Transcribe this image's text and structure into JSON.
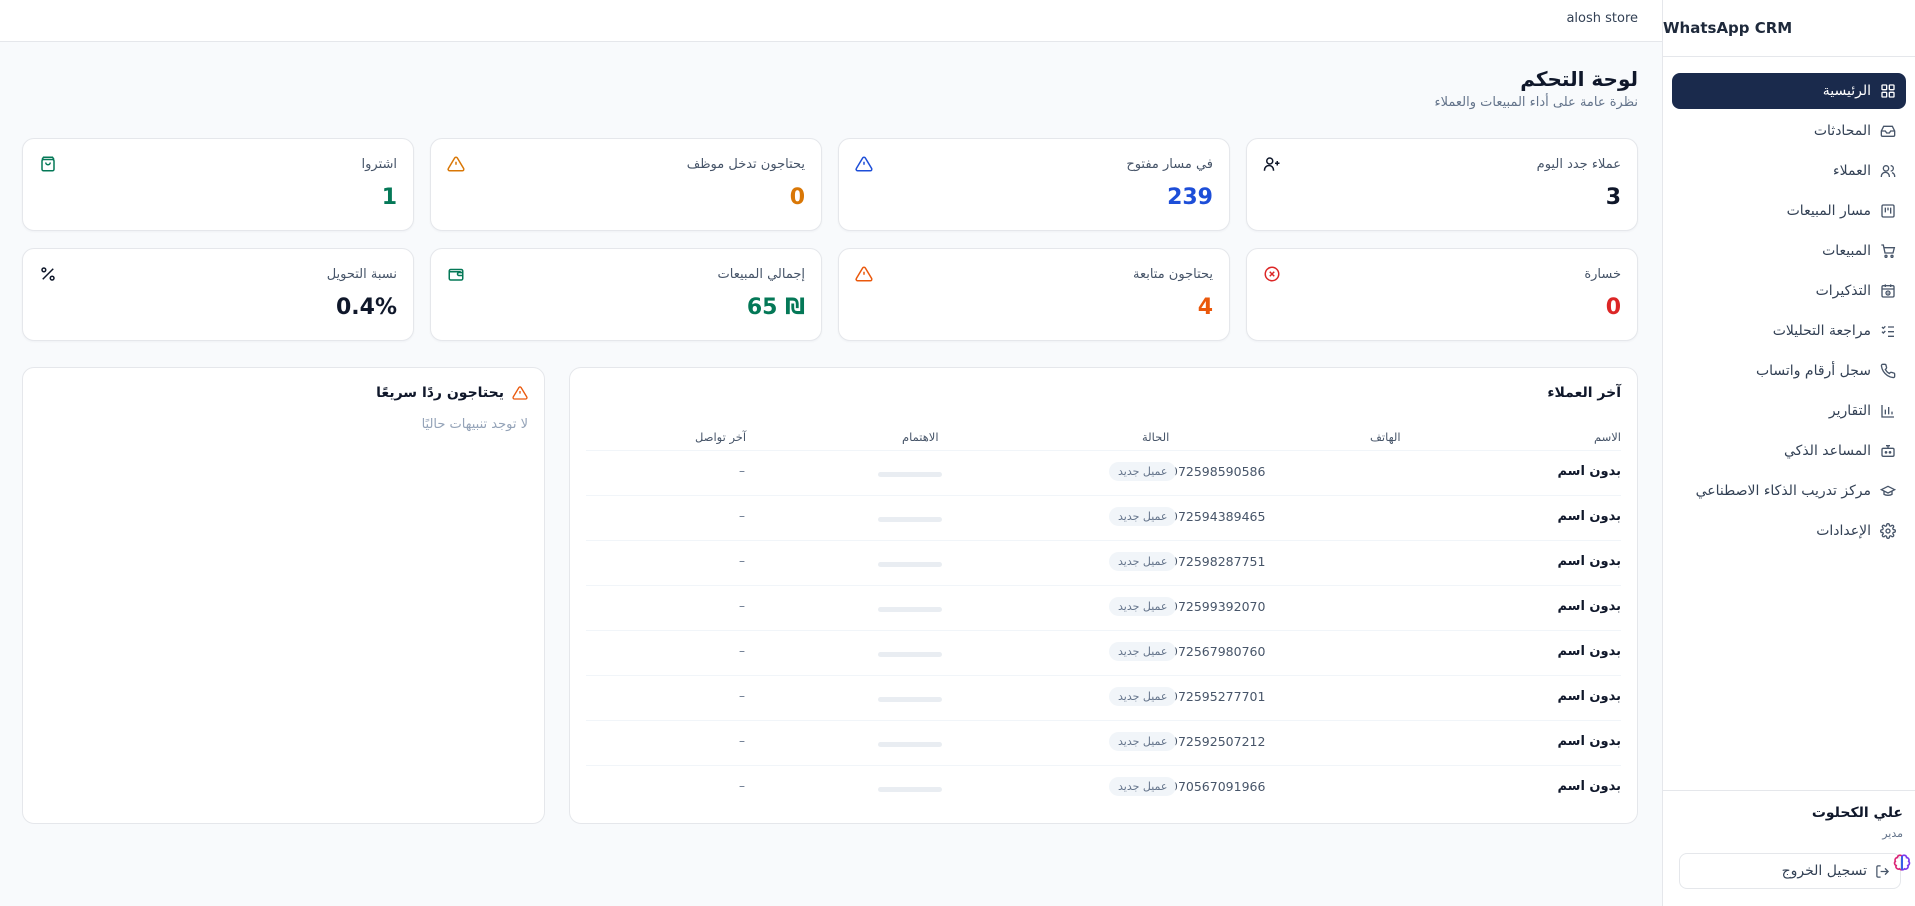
{
  "app": {
    "title": "WhatsApp CRM",
    "store_name": "alosh store"
  },
  "sidebar": {
    "items": [
      {
        "label": "الرئيسية",
        "icon": "dashboard-grid-icon",
        "active": true
      },
      {
        "label": "المحادثات",
        "icon": "inbox-icon",
        "active": false
      },
      {
        "label": "العملاء",
        "icon": "users-icon",
        "active": false
      },
      {
        "label": "مسار المبيعات",
        "icon": "kanban-icon",
        "active": false
      },
      {
        "label": "المبيعات",
        "icon": "cart-icon",
        "active": false
      },
      {
        "label": "التذكيرات",
        "icon": "calendar-clock-icon",
        "active": false
      },
      {
        "label": "مراجعة التحليلات",
        "icon": "checklist-icon",
        "active": false
      },
      {
        "label": "سجل أرقام واتساب",
        "icon": "phone-icon",
        "active": false
      },
      {
        "label": "التقارير",
        "icon": "bar-chart-icon",
        "active": false
      },
      {
        "label": "المساعد الذكي",
        "icon": "bot-icon",
        "active": false
      },
      {
        "label": "مركز تدريب الذكاء الاصطناعي",
        "icon": "graduation-cap-icon",
        "active": false
      },
      {
        "label": "الإعدادات",
        "icon": "gear-icon",
        "active": false
      }
    ],
    "user": {
      "name": "علي الكحلوت",
      "role": "مدير",
      "logout_label": "تسجيل الخروج"
    }
  },
  "header": {
    "title": "لوحة التحكم",
    "subtitle": "نظرة عامة على أداء المبيعات والعملاء"
  },
  "stats": [
    {
      "label": "عملاء جدد اليوم",
      "value": "3",
      "icon": "user-plus-icon",
      "color": "#0f172a"
    },
    {
      "label": "في مسار مفتوح",
      "value": "239",
      "icon": "alert-triangle-icon",
      "color": "#1d4ed8"
    },
    {
      "label": "يحتاجون تدخل موظف",
      "value": "0",
      "icon": "alert-triangle-icon",
      "color": "#d97706"
    },
    {
      "label": "اشتروا",
      "value": "1",
      "icon": "shopping-bag-icon",
      "color": "#047857"
    },
    {
      "label": "خسارة",
      "value": "0",
      "icon": "x-circle-icon",
      "color": "#dc2626"
    },
    {
      "label": "يحتاجون متابعة",
      "value": "4",
      "icon": "alert-triangle-icon",
      "color": "#ea580c"
    },
    {
      "label": "إجمالي المبيعات",
      "value": "₪ 65",
      "icon": "wallet-icon",
      "color": "#047857"
    },
    {
      "label": "نسبة التحويل",
      "value": "0.4%",
      "icon": "percent-icon",
      "color": "#0f172a"
    }
  ],
  "recent_customers": {
    "title": "آخر العملاء",
    "columns": {
      "name": "الاسم",
      "phone": "الهاتف",
      "status": "الحالة",
      "interest": "الاهتمام",
      "last_contact": "آخر تواصل"
    },
    "rows": [
      {
        "name": "بدون اسم",
        "phone": "972598590586",
        "status": "عميل جديد",
        "interest": 0,
        "last_contact": "–"
      },
      {
        "name": "بدون اسم",
        "phone": "972594389465",
        "status": "عميل جديد",
        "interest": 0,
        "last_contact": "–"
      },
      {
        "name": "بدون اسم",
        "phone": "972598287751",
        "status": "عميل جديد",
        "interest": 0,
        "last_contact": "–"
      },
      {
        "name": "بدون اسم",
        "phone": "972599392070",
        "status": "عميل جديد",
        "interest": 0,
        "last_contact": "–"
      },
      {
        "name": "بدون اسم",
        "phone": "972567980760",
        "status": "عميل جديد",
        "interest": 0,
        "last_contact": "–"
      },
      {
        "name": "بدون اسم",
        "phone": "972595277701",
        "status": "عميل جديد",
        "interest": 0,
        "last_contact": "–"
      },
      {
        "name": "بدون اسم",
        "phone": "972592507212",
        "status": "عميل جديد",
        "interest": 0,
        "last_contact": "–"
      },
      {
        "name": "بدون اسم",
        "phone": "970567091966",
        "status": "عميل جديد",
        "interest": 0,
        "last_contact": "–"
      }
    ]
  },
  "alerts": {
    "title": "يحتاجون ردًا سريعًا",
    "empty_text": "لا توجد تنبيهات حاليًا"
  }
}
